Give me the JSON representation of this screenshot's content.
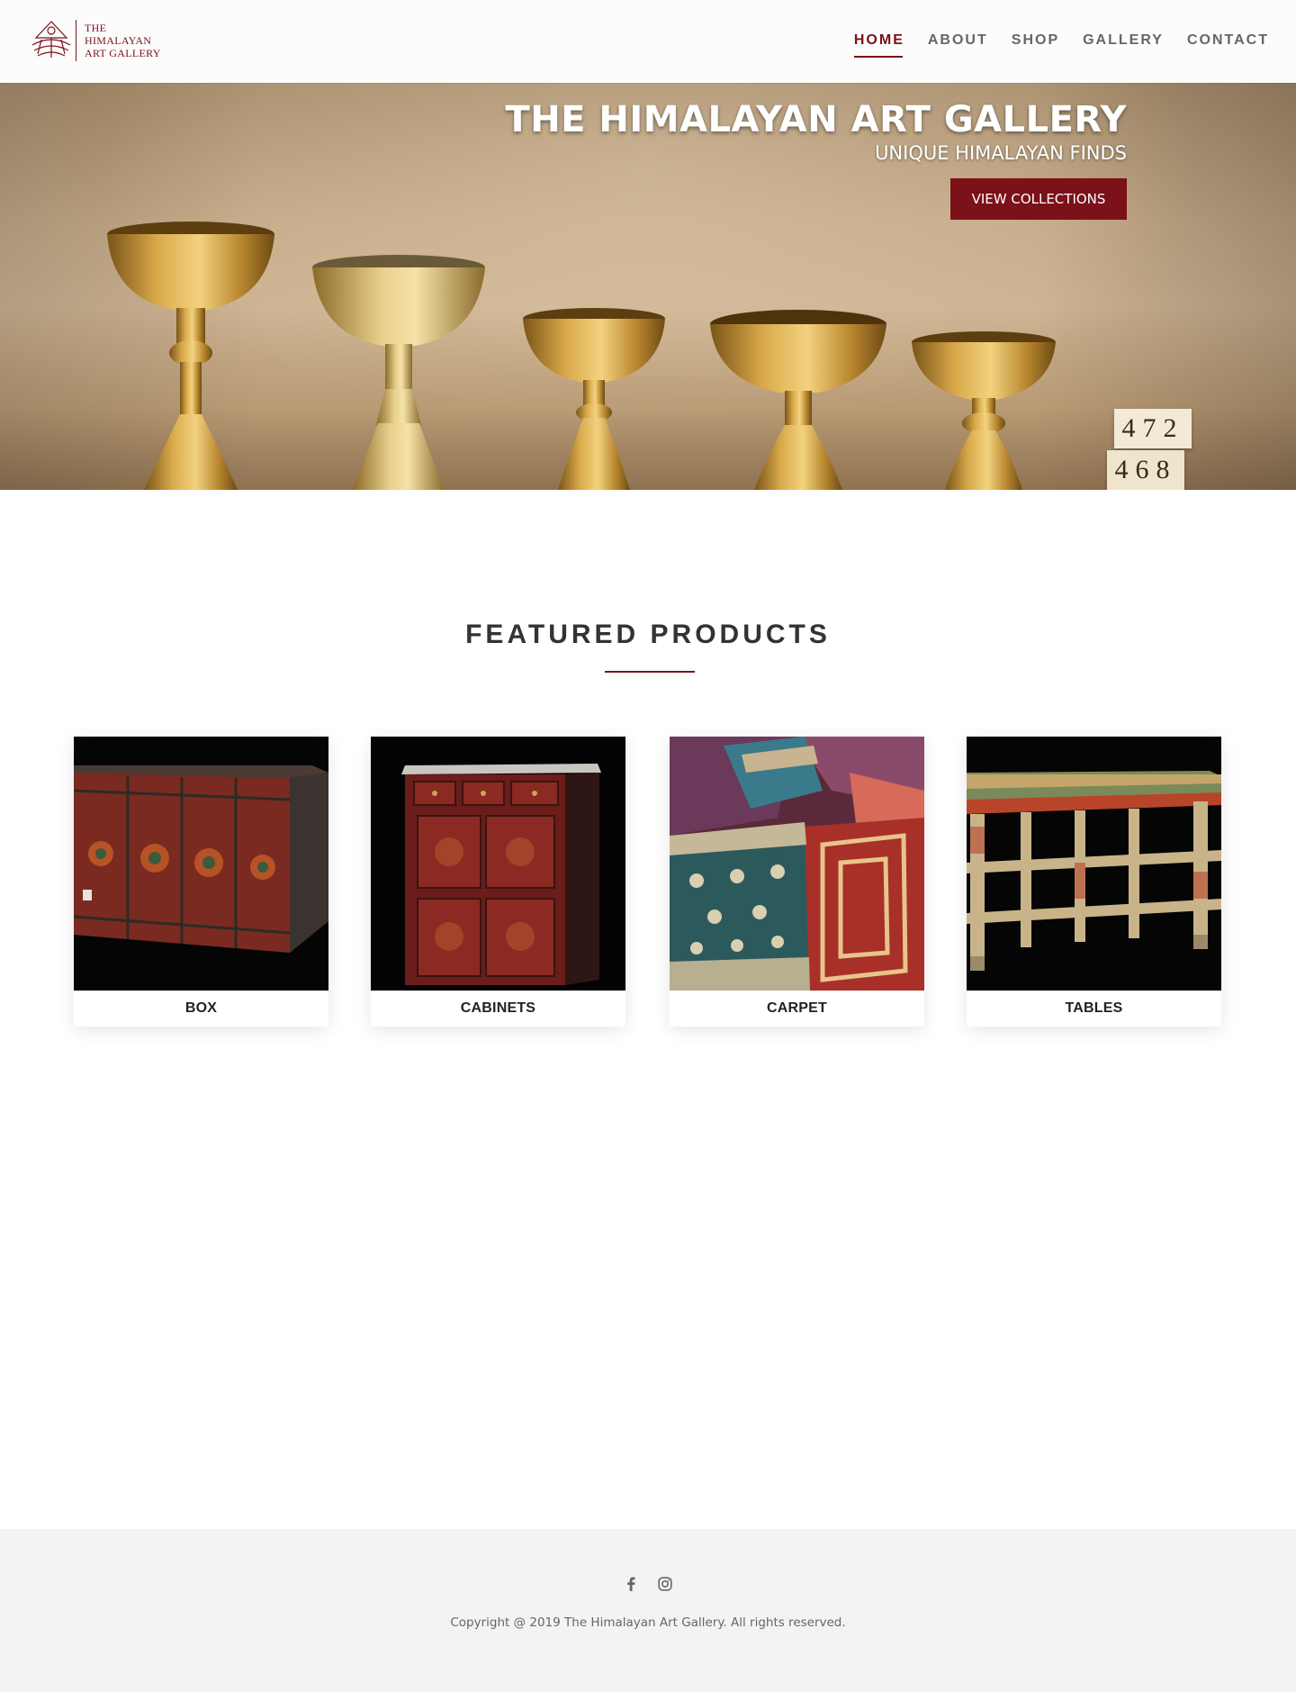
{
  "brand": {
    "logo_lines": [
      "THE",
      "HIMALAYAN",
      "ART GALLERY"
    ],
    "accent_color": "#7b1119"
  },
  "nav": {
    "items": [
      {
        "label": "HOME",
        "active": true
      },
      {
        "label": "ABOUT",
        "active": false
      },
      {
        "label": "SHOP",
        "active": false
      },
      {
        "label": "GALLERY",
        "active": false
      },
      {
        "label": "CONTACT",
        "active": false
      }
    ]
  },
  "hero": {
    "title": "THE HIMALAYAN ART GALLERY",
    "subtitle": "UNIQUE HIMALAYAN FINDS",
    "cta_label": "VIEW COLLECTIONS",
    "tag_numbers": [
      "472",
      "468"
    ]
  },
  "featured": {
    "heading": "FEATURED PRODUCTS",
    "products": [
      {
        "label": "BOX",
        "image": "painted-wooden-chest"
      },
      {
        "label": "CABINETS",
        "image": "red-painted-cabinet"
      },
      {
        "label": "CARPET",
        "image": "tibetan-carpets"
      },
      {
        "label": "TABLES",
        "image": "painted-low-table"
      }
    ]
  },
  "footer": {
    "social_icons": [
      "facebook-icon",
      "instagram-icon"
    ],
    "copyright": "Copyright @ 2019 The Himalayan Art Gallery. All rights reserved."
  }
}
